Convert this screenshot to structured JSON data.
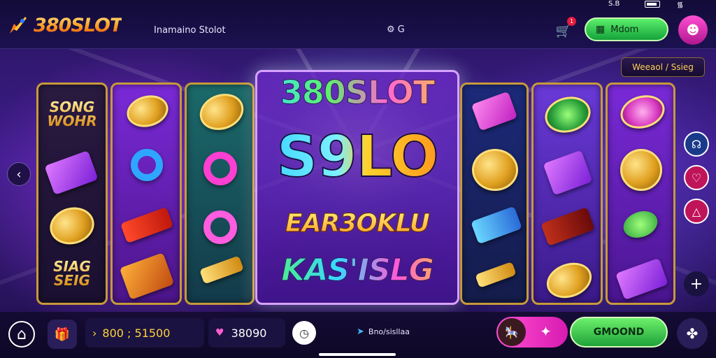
{
  "status_bar": {
    "left_text": "S.B",
    "wifi_icon": "wifi-icon"
  },
  "header": {
    "logo_text": "380SLOT",
    "site_name": "Inamaino Stolot",
    "center_label": "G",
    "cart_badge": "1",
    "mission_label": "Mdom",
    "profile_icon": "profile-icon"
  },
  "promo": {
    "label": "Weeaol / Ssieg"
  },
  "reels": {
    "reel1_top_word": "SONG WOHR",
    "reel1_bottom_word": "SIAG SEIG"
  },
  "center_panel": {
    "line1": "380SLOT",
    "line2": "S9LO",
    "line3": "EAR3OKLU",
    "line4": "KAS'ISLG"
  },
  "bottom_bar": {
    "balance": "800 ; 51500",
    "bet": "38090",
    "message": "Bno/sisllaa",
    "spin_label": "GMOOND"
  },
  "colors": {
    "accent_green": "#1fa23a",
    "accent_pink": "#d81bb0",
    "gold": "#ffd23a",
    "bg_purple": "#3d1d8a"
  }
}
